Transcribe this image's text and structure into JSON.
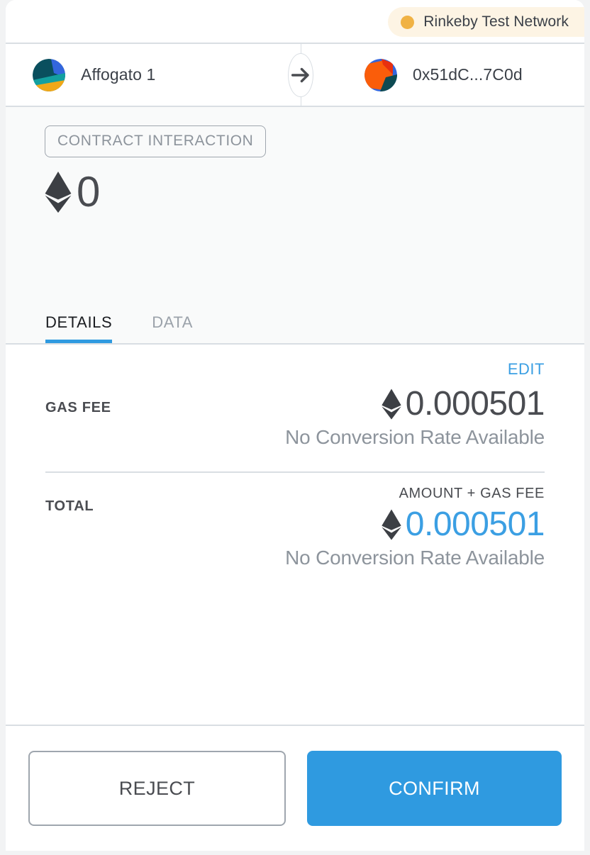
{
  "network": {
    "name": "Rinkeby Test Network",
    "dot_icon": "status-dot-icon",
    "dot_color": "#f0b244",
    "pill_bg": "#fdf4e4"
  },
  "transfer": {
    "from": {
      "label": "Affogato 1",
      "identicon": "jazzicon-sender",
      "colors": [
        "#0a4f5e",
        "#3366dd",
        "#13a0a0",
        "#f0a818"
      ]
    },
    "arrow_icon": "arrow-right-icon",
    "to": {
      "label": "0x51dC...7C0d",
      "identicon": "jazzicon-recipient",
      "colors": [
        "#3366dd",
        "#fa5d0a",
        "#e8300f",
        "#0d4a52"
      ]
    }
  },
  "transaction": {
    "type_badge": "CONTRACT INTERACTION",
    "currency_icon": "ethereum-icon",
    "amount": "0"
  },
  "tabs": [
    {
      "label": "DETAILS",
      "active": true
    },
    {
      "label": "DATA",
      "active": false
    }
  ],
  "details": {
    "edit_label": "EDIT",
    "gas_fee": {
      "label": "GAS FEE",
      "currency_icon": "ethereum-icon",
      "value": "0.000501",
      "conversion_note": "No Conversion Rate Available"
    },
    "total": {
      "label": "TOTAL",
      "header": "AMOUNT + GAS FEE",
      "currency_icon": "ethereum-icon",
      "value": "0.000501",
      "conversion_note": "No Conversion Rate Available",
      "value_color": "#3b9fe3"
    }
  },
  "footer": {
    "reject_label": "REJECT",
    "confirm_label": "CONFIRM",
    "confirm_color": "#2f9ae0"
  }
}
